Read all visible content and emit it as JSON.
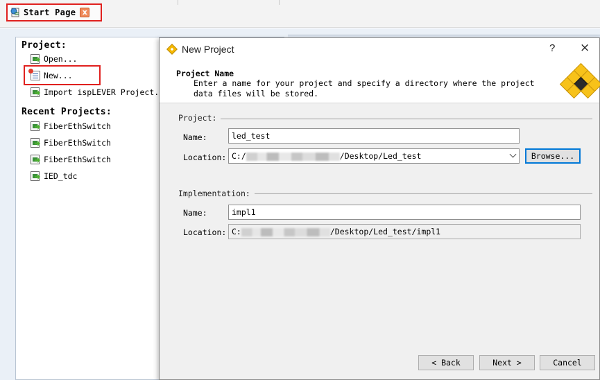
{
  "tab": {
    "label": "Start Page",
    "close_glyph": "x"
  },
  "start_page": {
    "project_heading": "Project:",
    "project_items": [
      {
        "label": "Open...",
        "icon": "open-project-icon"
      },
      {
        "label": "New...",
        "icon": "new-project-icon"
      },
      {
        "label": "Import ispLEVER Project...",
        "icon": "import-project-icon"
      }
    ],
    "recent_heading": "Recent Projects:",
    "recent_items": [
      {
        "label": "FiberEthSwitch"
      },
      {
        "label": "FiberEthSwitch"
      },
      {
        "label": "FiberEthSwitch"
      },
      {
        "label": "IED_tdc"
      }
    ]
  },
  "dialog": {
    "title": "New Project",
    "help_glyph": "?",
    "close_glyph": "×",
    "header_title": "Project Name",
    "header_desc": "Enter a name for your project and specify a directory where the project data files will be stored.",
    "project_group": "Project:",
    "project_name_label": "Name:",
    "project_name_value": "led_test",
    "project_location_label": "Location:",
    "project_location_prefix": "C:/",
    "project_location_suffix": "/Desktop/Led_test",
    "browse_label": "Browse...",
    "impl_group": "Implementation:",
    "impl_name_label": "Name:",
    "impl_name_value": "impl1",
    "impl_location_label": "Location:",
    "impl_location_prefix": "C:",
    "impl_location_suffix": "/Desktop/Led_test/impl1",
    "back_label": "< Back",
    "next_label": "Next >",
    "cancel_label": "Cancel"
  },
  "colors": {
    "highlight": "#e0201e",
    "accent": "#0078d7",
    "logo_yellow": "#f7c21a"
  }
}
